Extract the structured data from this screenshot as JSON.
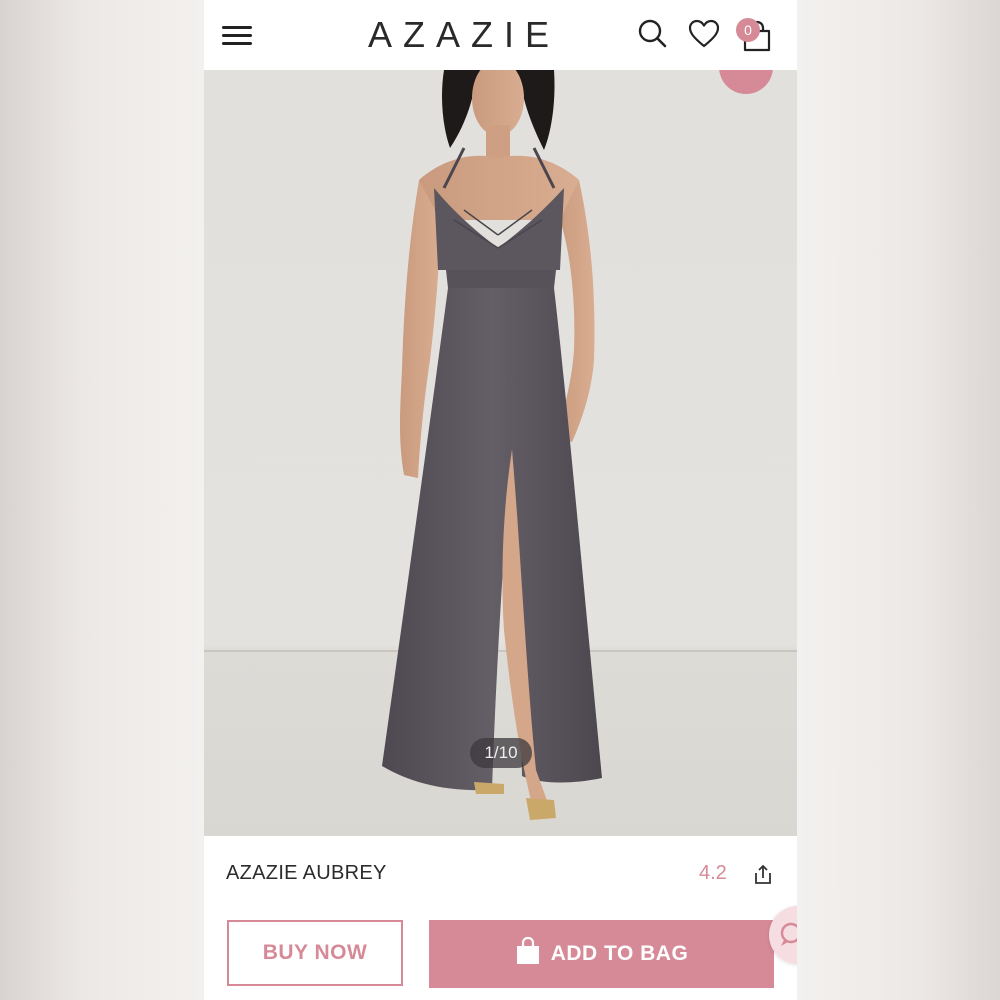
{
  "header": {
    "logo": "AZAZIE",
    "cart_count": "0",
    "icons": [
      "menu-icon",
      "search-icon",
      "heart-icon",
      "shopping-bag-icon"
    ]
  },
  "gallery": {
    "counter": "1/10"
  },
  "product": {
    "name": "AZAZIE AUBREY",
    "rating": "4.2"
  },
  "actions": {
    "buy_now": "BUY NOW",
    "add_to_bag": "ADD TO BAG"
  },
  "colors": {
    "accent": "#d68a98",
    "dress": "#5a545c",
    "background": "#e2e0dc"
  }
}
